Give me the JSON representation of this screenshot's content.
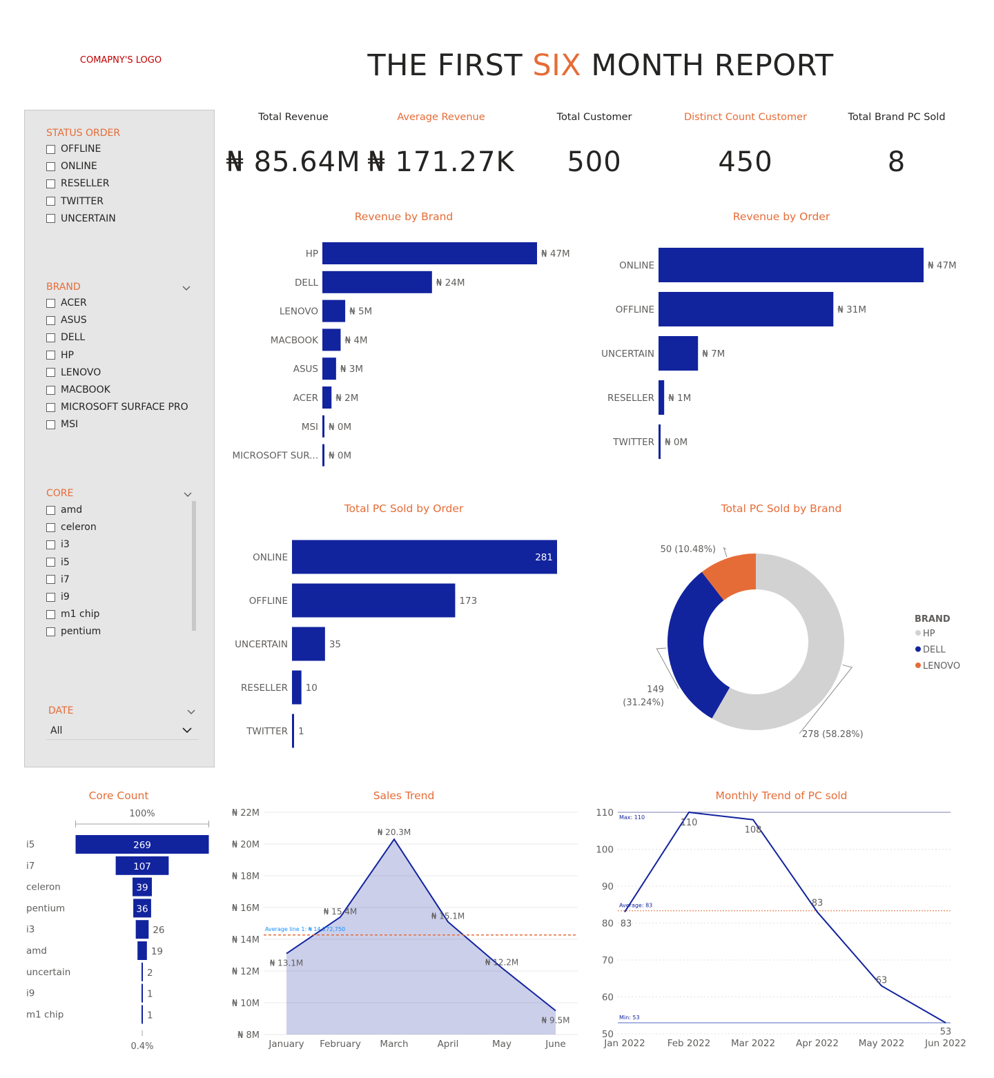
{
  "header": {
    "logo_text": "COMAPNY'S LOGO",
    "title_part1": "THE FIRST ",
    "title_highlight": "SIX",
    "title_part2": " MONTH REPORT"
  },
  "colors": {
    "accent": "#e66c37",
    "bar": "#12239e",
    "grey": "#d2d2d2",
    "panel": "#e6e6e6"
  },
  "slicers": {
    "status_order": {
      "label": "STATUS ORDER",
      "items": [
        "OFFLINE",
        "ONLINE",
        "RESELLER",
        "TWITTER",
        "UNCERTAIN"
      ]
    },
    "brand": {
      "label": "BRAND",
      "items": [
        "ACER",
        "ASUS",
        "DELL",
        "HP",
        "LENOVO",
        "MACBOOK",
        "MICROSOFT SURFACE PRO",
        "MSI"
      ]
    },
    "core": {
      "label": "CORE",
      "items": [
        "amd",
        "celeron",
        "i3",
        "i5",
        "i7",
        "i9",
        "m1 chip",
        "pentium"
      ]
    },
    "date": {
      "label": "DATE",
      "selected": "All"
    }
  },
  "kpis": [
    {
      "label": "Total Revenue",
      "value": "₦ 85.64M"
    },
    {
      "label": "Average Revenue",
      "value": "₦ 171.27K"
    },
    {
      "label": "Total Customer",
      "value": "500"
    },
    {
      "label": "Distinct Count Customer",
      "value": "450"
    },
    {
      "label": "Total Brand PC Sold",
      "value": "8"
    }
  ],
  "chart_data": [
    {
      "id": "revenue_by_brand",
      "type": "bar",
      "title": "Revenue by Brand",
      "categories": [
        "HP",
        "DELL",
        "LENOVO",
        "MACBOOK",
        "ASUS",
        "ACER",
        "MSI",
        "MICROSOFT SUR..."
      ],
      "values": [
        47,
        24,
        5,
        4,
        3,
        2,
        0,
        0
      ],
      "labels": [
        "₦ 47M",
        "₦ 24M",
        "₦ 5M",
        "₦ 4M",
        "₦ 3M",
        "₦ 2M",
        "₦ 0M",
        "₦ 0M"
      ],
      "unit": "M"
    },
    {
      "id": "revenue_by_order",
      "type": "bar",
      "title": "Revenue by Order",
      "categories": [
        "ONLINE",
        "OFFLINE",
        "UNCERTAIN",
        "RESELLER",
        "TWITTER"
      ],
      "values": [
        47,
        31,
        7,
        1,
        0
      ],
      "labels": [
        "₦ 47M",
        "₦ 31M",
        "₦ 7M",
        "₦ 1M",
        "₦ 0M"
      ],
      "unit": "M"
    },
    {
      "id": "pc_sold_by_order",
      "type": "bar",
      "title": "Total PC Sold by Order",
      "categories": [
        "ONLINE",
        "OFFLINE",
        "UNCERTAIN",
        "RESELLER",
        "TWITTER"
      ],
      "values": [
        281,
        173,
        35,
        10,
        1
      ]
    },
    {
      "id": "pc_sold_by_brand",
      "type": "pie",
      "title": "Total PC Sold by Brand",
      "legend_title": "BRAND",
      "slices": [
        {
          "name": "HP",
          "value": 278,
          "label": "278 (58.28%)",
          "color": "#d2d2d2"
        },
        {
          "name": "DELL",
          "value": 149,
          "label": "149 (31.24%)",
          "color": "#12239e"
        },
        {
          "name": "LENOVO",
          "value": 50,
          "label": "50 (10.48%)",
          "color": "#e66c37"
        }
      ]
    },
    {
      "id": "core_count",
      "type": "bar",
      "title": "Core Count",
      "top_label": "100%",
      "bottom_label": "0.4%",
      "categories": [
        "i5",
        "i7",
        "celeron",
        "pentium",
        "i3",
        "amd",
        "uncertain",
        "i9",
        "m1 chip"
      ],
      "values": [
        269,
        107,
        39,
        36,
        26,
        19,
        2,
        1,
        1
      ]
    },
    {
      "id": "sales_trend",
      "type": "area",
      "title": "Sales Trend",
      "x": [
        "January",
        "February",
        "March",
        "April",
        "May",
        "June"
      ],
      "values": [
        13.1,
        15.4,
        20.3,
        15.1,
        12.2,
        9.5
      ],
      "labels": [
        "₦ 13.1M",
        "₦ 15.4M",
        "₦ 20.3M",
        "₦ 15.1M",
        "₦ 12.2M",
        "₦ 9.5M"
      ],
      "ylim": [
        8,
        22
      ],
      "yticks": [
        "₦ 8M",
        "₦ 10M",
        "₦ 12M",
        "₦ 14M",
        "₦ 16M",
        "₦ 18M",
        "₦ 20M",
        "₦ 22M"
      ],
      "average": 14.27,
      "average_label": "Average line 1: ₦ 14,272,750"
    },
    {
      "id": "monthly_trend",
      "type": "line",
      "title": "Monthly Trend of PC sold",
      "x": [
        "Jan 2022",
        "Feb 2022",
        "Mar 2022",
        "Apr 2022",
        "May 2022",
        "Jun 2022"
      ],
      "values": [
        83,
        110,
        108,
        83,
        63,
        53
      ],
      "ylim": [
        50,
        110
      ],
      "yticks": [
        "50",
        "60",
        "70",
        "80",
        "90",
        "100",
        "110"
      ],
      "max_label": "Max: 110",
      "max": 110,
      "min_label": "Min: 53",
      "min": 53,
      "average_label": "Average: 83",
      "average": 83.33
    }
  ]
}
